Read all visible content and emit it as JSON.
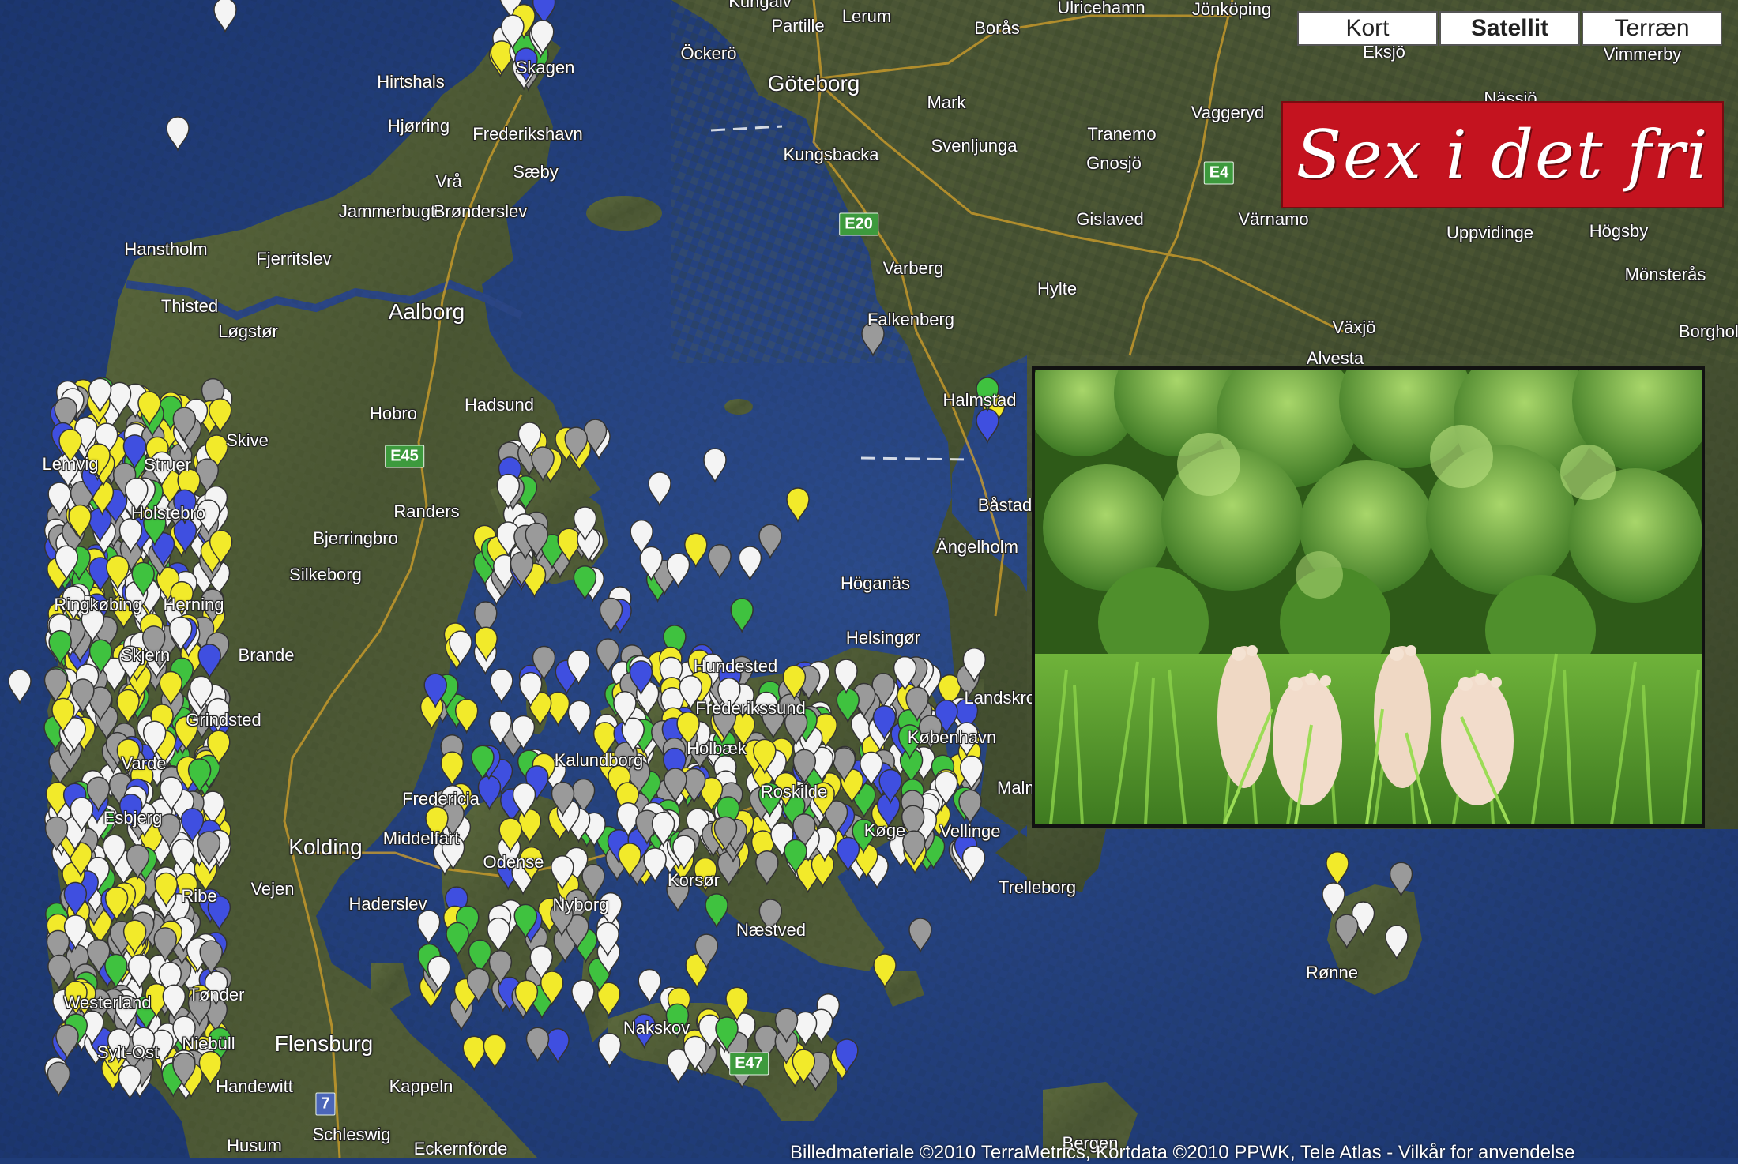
{
  "map_type_controls": {
    "map": "Kort",
    "satellite": "Satellit",
    "terrain": "Terræn",
    "active": "satellite"
  },
  "banner": {
    "title": "Sex i det fri",
    "color": "#c4131f"
  },
  "attribution": "Billedmaterialе ©2010 TerraMetrics, Kortdata ©2010 PPWK, Tele Atlas - Vilkår for anvendelse",
  "places": [
    "Skagen",
    "Hirtshals",
    "Hjørring",
    "Frederikshavn",
    "Sæby",
    "Brønderslev",
    "Vrå",
    "Jammerbugt",
    "Hanstholm",
    "Fjerritslev",
    "Aalborg",
    "Thisted",
    "Løgstør",
    "Hobro",
    "Hadsund",
    "Skive",
    "Lemvig",
    "Struer",
    "Holstebro",
    "Randers",
    "Bjerringbro",
    "Silkeborg",
    "Ringkøbing",
    "Herning",
    "Skjern",
    "Brande",
    "Grindsted",
    "Varde",
    "Esbjerg",
    "Fredericia",
    "Middelfart",
    "Kolding",
    "Ribe",
    "Vejen",
    "Haderslev",
    "Tønder",
    "Westerland",
    "Sylt-Ost",
    "Niebüll",
    "Flensburg",
    "Handewitt",
    "Kappeln",
    "Schleswig",
    "Husum",
    "Eckernförde",
    "Odense",
    "Nyborg",
    "Kalundborg",
    "Holbæk",
    "Roskilde",
    "Køge",
    "Korsør",
    "Næstved",
    "Nakskov",
    "Frederikssund",
    "Hundested",
    "Helsingør",
    "København",
    "Höganäs",
    "Ängelholm",
    "Båstad",
    "Halmstad",
    "Landskrona",
    "Malmö",
    "Vellinge",
    "Trelleborg",
    "Rønne",
    "Bergen",
    "Göteborg",
    "Kungsbacka",
    "Mark",
    "Borås",
    "Svenljunga",
    "Tranemo",
    "Gnosjö",
    "Gislaved",
    "Värnamo",
    "Vaggeryd",
    "Jönköping",
    "Varberg",
    "Falkenberg",
    "Hylte",
    "Växjö",
    "Alvesta",
    "Uppvidinge",
    "Högsby",
    "Mönsterås",
    "Borgholm",
    "Öckerö",
    "Partille",
    "Lerum",
    "Ulricehamn",
    "Eksjö",
    "Vimmerby",
    "Nässjö",
    "Kungälv"
  ],
  "road_labels": [
    "E4",
    "E20",
    "E45",
    "E47",
    "7"
  ],
  "marker_colors": {
    "white": "#f4f4f4",
    "grey": "#9a9a9a",
    "yellow": "#f2ea2a",
    "green": "#3fc23f",
    "blue": "#3f4fe0"
  },
  "colors": {
    "sea": "#24417e",
    "land": "#4d5a35"
  }
}
